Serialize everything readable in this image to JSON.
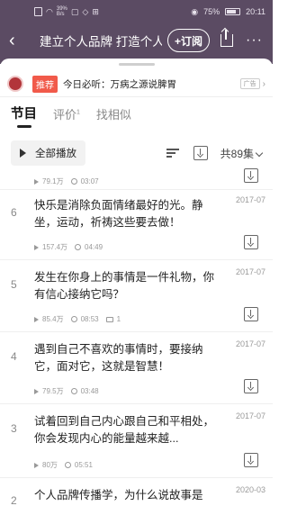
{
  "status_bar": {
    "left_small": "39%",
    "left_small2": "B/s",
    "battery": "75%",
    "time": "20:11"
  },
  "titlebar": {
    "title": "建立个人品牌 打造个人",
    "subscribe": "+订阅"
  },
  "ad": {
    "tag": "推荐",
    "text": "今日必听：万病之源说脾胃",
    "badge": "广告"
  },
  "tabs": [
    {
      "label": "节目",
      "active": true
    },
    {
      "label": "评价",
      "sup": "1"
    },
    {
      "label": "找相似"
    }
  ],
  "toolbar": {
    "play_all": "全部播放",
    "count": "共89集"
  },
  "episodes": [
    {
      "num": "",
      "text": "",
      "date": "",
      "plays": "79.1万",
      "duration": "03:07",
      "comments": ""
    },
    {
      "num": "6",
      "text": "快乐是消除负面情绪最好的光。静坐，运动，祈祷这些要去做！",
      "date": "2017-07",
      "plays": "157.4万",
      "duration": "04:49",
      "comments": ""
    },
    {
      "num": "5",
      "text": "发生在你身上的事情是一件礼物，你有信心接纳它吗？",
      "date": "2017-07",
      "plays": "85.4万",
      "duration": "08:53",
      "comments": "1"
    },
    {
      "num": "4",
      "text": "遇到自己不喜欢的事情时，要接纳它，面对它，这就是智慧！",
      "date": "2017-07",
      "plays": "79.5万",
      "duration": "03:48",
      "comments": ""
    },
    {
      "num": "3",
      "text": "试着回到自己内心跟自己和平相处，你会发现内心的能量越来越...",
      "date": "2017-07",
      "plays": "80万",
      "duration": "05:51",
      "comments": ""
    },
    {
      "num": "2",
      "text": "个人品牌传播学，为什么说故事是",
      "date": "2020-03",
      "plays": "",
      "duration": "",
      "comments": ""
    }
  ]
}
